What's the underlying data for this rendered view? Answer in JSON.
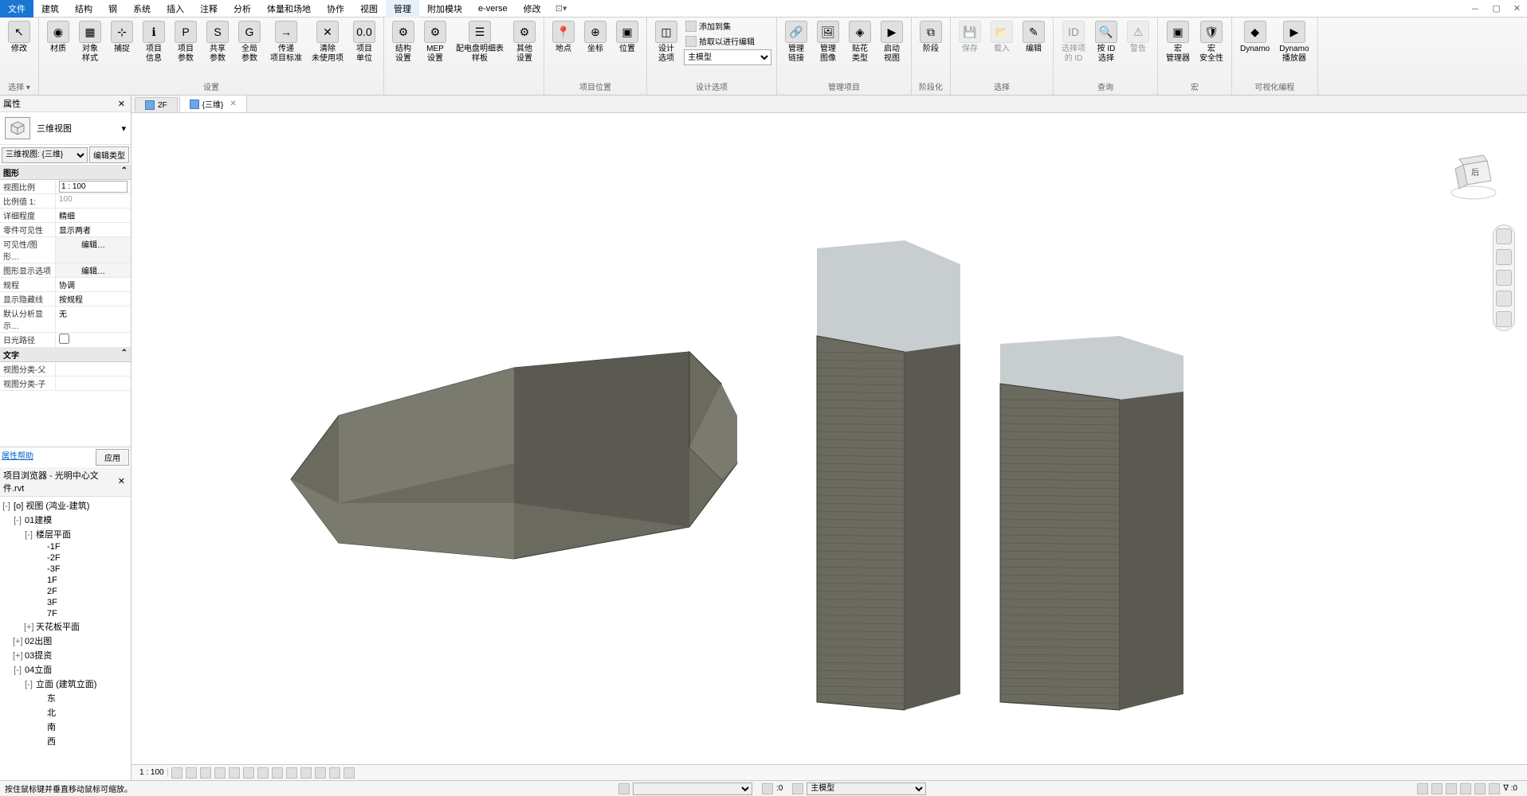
{
  "menu": [
    "文件",
    "建筑",
    "结构",
    "钢",
    "系统",
    "插入",
    "注释",
    "分析",
    "体量和场地",
    "协作",
    "视图",
    "管理",
    "附加模块",
    "e-verse",
    "修改"
  ],
  "menu_active_index": 0,
  "menu_selected_index": 11,
  "ribbon": {
    "panels": [
      {
        "label": "选择 ▾",
        "buttons": [
          {
            "lbl": "修改",
            "ico": "↕"
          }
        ]
      },
      {
        "label": "设置",
        "buttons": [
          {
            "lbl": "材质",
            "ico": "◉"
          },
          {
            "lbl": "对象\n样式",
            "ico": "▦"
          },
          {
            "lbl": "捕捉",
            "ico": "⊹"
          },
          {
            "lbl": "项目\n信息",
            "ico": "ℹ"
          },
          {
            "lbl": "项目\n参数",
            "ico": "P"
          },
          {
            "lbl": "共享\n参数",
            "ico": "S"
          },
          {
            "lbl": "全局\n参数",
            "ico": "G"
          },
          {
            "lbl": "传递\n项目标准",
            "ico": "→"
          },
          {
            "lbl": "清除\n未使用项",
            "ico": "✕"
          },
          {
            "lbl": "项目\n单位",
            "ico": "0.0"
          }
        ]
      },
      {
        "label": "",
        "buttons": [
          {
            "lbl": "结构\n设置",
            "ico": "⚙"
          },
          {
            "lbl": "MEP\n设置",
            "ico": "⚙"
          },
          {
            "lbl": "配电盘明细表\n样板",
            "ico": "☰"
          },
          {
            "lbl": "其他\n设置",
            "ico": "⚙"
          }
        ]
      },
      {
        "label": "项目位置",
        "buttons": [
          {
            "lbl": "地点",
            "ico": "📍"
          },
          {
            "lbl": "坐标",
            "ico": "⊕"
          },
          {
            "lbl": "位置",
            "ico": "▣"
          }
        ]
      },
      {
        "label": "设计选项",
        "buttons": [
          {
            "lbl": "设计\n选项",
            "ico": "◫"
          }
        ],
        "small": [
          {
            "lbl": "添加到集",
            "dis": true
          },
          {
            "lbl": "拾取以进行编辑",
            "dis": true
          }
        ],
        "select_value": "主模型"
      },
      {
        "label": "管理项目",
        "buttons": [
          {
            "lbl": "管理\n链接",
            "ico": "🔗"
          },
          {
            "lbl": "管理\n图像",
            "ico": "🖼"
          },
          {
            "lbl": "贴花\n类型",
            "ico": "◈"
          },
          {
            "lbl": "启动\n视图",
            "ico": "▶"
          }
        ]
      },
      {
        "label": "阶段化",
        "buttons": [
          {
            "lbl": "阶段",
            "ico": "⧉"
          }
        ]
      },
      {
        "label": "选择",
        "buttons": [
          {
            "lbl": "保存",
            "dis": true
          },
          {
            "lbl": "载入",
            "dis": true
          },
          {
            "lbl": "编辑"
          }
        ]
      },
      {
        "label": "查询",
        "buttons": [
          {
            "lbl": "选择项\n的 ID",
            "dis": true
          },
          {
            "lbl": "按 ID\n选择"
          },
          {
            "lbl": "警告",
            "dis": true
          }
        ]
      },
      {
        "label": "宏",
        "buttons": [
          {
            "lbl": "宏\n管理器",
            "ico": "▣"
          },
          {
            "lbl": "宏\n安全性",
            "ico": "🛡"
          }
        ]
      },
      {
        "label": "可视化编程",
        "buttons": [
          {
            "lbl": "Dynamo",
            "ico": "◆"
          },
          {
            "lbl": "Dynamo\n播放器",
            "ico": "▶"
          }
        ]
      }
    ]
  },
  "properties": {
    "title": "属性",
    "view_type": "三维视图",
    "type_selector": "三维视图: {三维}",
    "edit_type": "编辑类型",
    "groups": [
      {
        "name": "图形",
        "rows": [
          {
            "k": "视图比例",
            "v": "1 : 100",
            "input": true
          },
          {
            "k": "比例值 1:",
            "v": "100",
            "dis": true
          },
          {
            "k": "详细程度",
            "v": "精细"
          },
          {
            "k": "零件可见性",
            "v": "显示两者"
          },
          {
            "k": "可见性/图形…",
            "v": "编辑…",
            "btn": true
          },
          {
            "k": "图形显示选项",
            "v": "编辑…",
            "btn": true
          },
          {
            "k": "规程",
            "v": "协调"
          },
          {
            "k": "显示隐藏线",
            "v": "按规程"
          },
          {
            "k": "默认分析显示…",
            "v": "无"
          },
          {
            "k": "日光路径",
            "v": "",
            "check": true
          }
        ]
      },
      {
        "name": "文字",
        "rows": [
          {
            "k": "视图分类-父",
            "v": ""
          },
          {
            "k": "视图分类-子",
            "v": ""
          }
        ]
      }
    ],
    "help": "属性帮助",
    "apply": "应用"
  },
  "browser": {
    "title": "项目浏览器 - 光明中心文件.rvt",
    "tree": [
      {
        "lvl": 1,
        "exp": "-",
        "lbl": "[o] 视图 (鸿业-建筑)"
      },
      {
        "lvl": 2,
        "exp": "-",
        "lbl": "01建模"
      },
      {
        "lvl": 3,
        "exp": "-",
        "lbl": "楼层平面"
      },
      {
        "lvl": 4,
        "lbl": "-1F"
      },
      {
        "lvl": 4,
        "lbl": "-2F"
      },
      {
        "lvl": 4,
        "lbl": "-3F"
      },
      {
        "lvl": 4,
        "lbl": "1F"
      },
      {
        "lvl": 4,
        "lbl": "2F"
      },
      {
        "lvl": 4,
        "lbl": "3F"
      },
      {
        "lvl": 4,
        "lbl": "7F"
      },
      {
        "lvl": 3,
        "exp": "+",
        "lbl": "天花板平面"
      },
      {
        "lvl": 2,
        "exp": "+",
        "lbl": "02出图"
      },
      {
        "lvl": 2,
        "exp": "+",
        "lbl": "03提资"
      },
      {
        "lvl": 2,
        "exp": "-",
        "lbl": "04立面"
      },
      {
        "lvl": 3,
        "exp": "-",
        "lbl": "立面 (建筑立面)"
      },
      {
        "lvl": 4,
        "lbl": "东"
      },
      {
        "lvl": 4,
        "lbl": "北"
      },
      {
        "lvl": 4,
        "lbl": "南"
      },
      {
        "lvl": 4,
        "lbl": "西"
      }
    ]
  },
  "tabs": [
    {
      "label": "2F",
      "active": false
    },
    {
      "label": "{三维}",
      "active": true
    }
  ],
  "viewcube_label": "后",
  "view_scale": "1 : 100",
  "status_msg": "按住鼠标键并垂直移动鼠标可缩放。",
  "status_main_model": "主模型",
  "status_zero": ":0",
  "status_filter": "∇ :0"
}
